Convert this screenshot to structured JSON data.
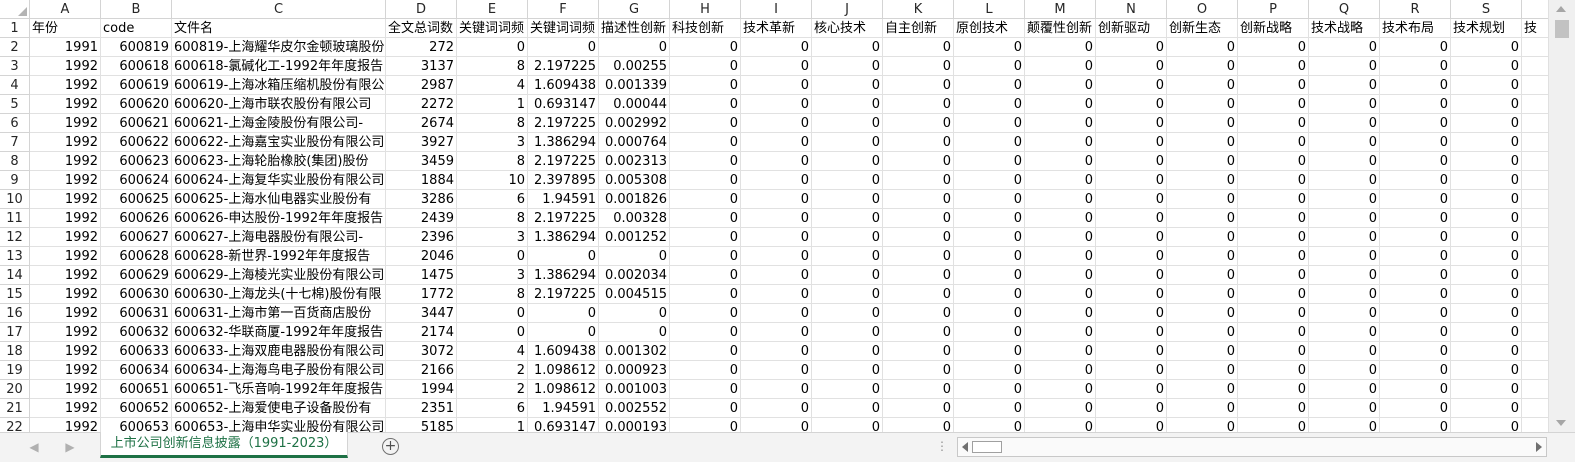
{
  "columns": [
    {
      "letter": "A",
      "header": "年份"
    },
    {
      "letter": "B",
      "header": "code"
    },
    {
      "letter": "C",
      "header": "文件名"
    },
    {
      "letter": "D",
      "header": "全文总词数"
    },
    {
      "letter": "E",
      "header": "关键词词频"
    },
    {
      "letter": "F",
      "header": "关键词词频"
    },
    {
      "letter": "G",
      "header": "描述性创新"
    },
    {
      "letter": "H",
      "header": "科技创新"
    },
    {
      "letter": "I",
      "header": "技术革新"
    },
    {
      "letter": "J",
      "header": "核心技术"
    },
    {
      "letter": "K",
      "header": "自主创新"
    },
    {
      "letter": "L",
      "header": "原创技术"
    },
    {
      "letter": "M",
      "header": "颠覆性创新"
    },
    {
      "letter": "N",
      "header": "创新驱动"
    },
    {
      "letter": "O",
      "header": "创新生态"
    },
    {
      "letter": "P",
      "header": "创新战略"
    },
    {
      "letter": "Q",
      "header": "技术战略"
    },
    {
      "letter": "R",
      "header": "技术布局"
    },
    {
      "letter": "S",
      "header": "技术规划"
    },
    {
      "letter": "",
      "header": "技"
    }
  ],
  "rows": [
    [
      "1991",
      "600819",
      "600819-上海耀华皮尔金顿玻璃股份",
      "272",
      "0",
      "0",
      "0",
      "0",
      "0",
      "0",
      "0",
      "0",
      "0",
      "0",
      "0",
      "0",
      "0",
      "0",
      "0",
      "0"
    ],
    [
      "1992",
      "600618",
      "600618-氯碱化工-1992年年度报告",
      "3137",
      "8",
      "2.197225",
      "0.00255",
      "0",
      "0",
      "0",
      "0",
      "0",
      "0",
      "0",
      "0",
      "0",
      "0",
      "0",
      "0",
      "0"
    ],
    [
      "1992",
      "600619",
      "600619-上海冰箱压缩机股份有限公司",
      "2987",
      "4",
      "1.609438",
      "0.001339",
      "0",
      "0",
      "0",
      "0",
      "0",
      "0",
      "0",
      "0",
      "0",
      "0",
      "0",
      "0",
      "0"
    ],
    [
      "1992",
      "600620",
      "600620-上海市联农股份有限公司",
      "2272",
      "1",
      "0.693147",
      "0.00044",
      "0",
      "0",
      "0",
      "0",
      "0",
      "0",
      "0",
      "0",
      "0",
      "0",
      "0",
      "0",
      "0"
    ],
    [
      "1992",
      "600621",
      "600621-上海金陵股份有限公司-",
      "2674",
      "8",
      "2.197225",
      "0.002992",
      "0",
      "0",
      "0",
      "0",
      "0",
      "0",
      "0",
      "0",
      "0",
      "0",
      "0",
      "0",
      "0"
    ],
    [
      "1992",
      "600622",
      "600622-上海嘉宝实业股份有限公司",
      "3927",
      "3",
      "1.386294",
      "0.000764",
      "0",
      "0",
      "0",
      "0",
      "0",
      "0",
      "0",
      "0",
      "0",
      "0",
      "0",
      "0",
      "0"
    ],
    [
      "1992",
      "600623",
      "600623-上海轮胎橡胶(集团)股份",
      "3459",
      "8",
      "2.197225",
      "0.002313",
      "0",
      "0",
      "0",
      "0",
      "0",
      "0",
      "0",
      "0",
      "0",
      "0",
      "0",
      "0",
      "0"
    ],
    [
      "1992",
      "600624",
      "600624-上海复华实业股份有限公司",
      "1884",
      "10",
      "2.397895",
      "0.005308",
      "0",
      "0",
      "0",
      "0",
      "0",
      "0",
      "0",
      "0",
      "0",
      "0",
      "0",
      "0",
      "0"
    ],
    [
      "1992",
      "600625",
      "600625-上海水仙电器实业股份有",
      "3286",
      "6",
      "1.94591",
      "0.001826",
      "0",
      "0",
      "0",
      "0",
      "0",
      "0",
      "0",
      "0",
      "0",
      "0",
      "0",
      "0",
      "0"
    ],
    [
      "1992",
      "600626",
      "600626-申达股份-1992年年度报告",
      "2439",
      "8",
      "2.197225",
      "0.00328",
      "0",
      "0",
      "0",
      "0",
      "0",
      "0",
      "0",
      "0",
      "0",
      "0",
      "0",
      "0",
      "0"
    ],
    [
      "1992",
      "600627",
      "600627-上海电器股份有限公司-",
      "2396",
      "3",
      "1.386294",
      "0.001252",
      "0",
      "0",
      "0",
      "0",
      "0",
      "0",
      "0",
      "0",
      "0",
      "0",
      "0",
      "0",
      "0"
    ],
    [
      "1992",
      "600628",
      "600628-新世界-1992年年度报告",
      "2046",
      "0",
      "0",
      "0",
      "0",
      "0",
      "0",
      "0",
      "0",
      "0",
      "0",
      "0",
      "0",
      "0",
      "0",
      "0",
      "0"
    ],
    [
      "1992",
      "600629",
      "600629-上海棱光实业股份有限公司",
      "1475",
      "3",
      "1.386294",
      "0.002034",
      "0",
      "0",
      "0",
      "0",
      "0",
      "0",
      "0",
      "0",
      "0",
      "0",
      "0",
      "0",
      "0"
    ],
    [
      "1992",
      "600630",
      "600630-上海龙头(十七棉)股份有限",
      "1772",
      "8",
      "2.197225",
      "0.004515",
      "0",
      "0",
      "0",
      "0",
      "0",
      "0",
      "0",
      "0",
      "0",
      "0",
      "0",
      "0",
      "0"
    ],
    [
      "1992",
      "600631",
      "600631-上海市第一百货商店股份",
      "3447",
      "0",
      "0",
      "0",
      "0",
      "0",
      "0",
      "0",
      "0",
      "0",
      "0",
      "0",
      "0",
      "0",
      "0",
      "0",
      "0"
    ],
    [
      "1992",
      "600632",
      "600632-华联商厦-1992年年度报告",
      "2174",
      "0",
      "0",
      "0",
      "0",
      "0",
      "0",
      "0",
      "0",
      "0",
      "0",
      "0",
      "0",
      "0",
      "0",
      "0",
      "0"
    ],
    [
      "1992",
      "600633",
      "600633-上海双鹿电器股份有限公司",
      "3072",
      "4",
      "1.609438",
      "0.001302",
      "0",
      "0",
      "0",
      "0",
      "0",
      "0",
      "0",
      "0",
      "0",
      "0",
      "0",
      "0",
      "0"
    ],
    [
      "1992",
      "600634",
      "600634-上海海鸟电子股份有限公司",
      "2166",
      "2",
      "1.098612",
      "0.000923",
      "0",
      "0",
      "0",
      "0",
      "0",
      "0",
      "0",
      "0",
      "0",
      "0",
      "0",
      "0",
      "0"
    ],
    [
      "1992",
      "600651",
      "600651-飞乐音响-1992年年度报告",
      "1994",
      "2",
      "1.098612",
      "0.001003",
      "0",
      "0",
      "0",
      "0",
      "0",
      "0",
      "0",
      "0",
      "0",
      "0",
      "0",
      "0",
      "0"
    ],
    [
      "1992",
      "600652",
      "600652-上海爱使电子设备股份有",
      "2351",
      "6",
      "1.94591",
      "0.002552",
      "0",
      "0",
      "0",
      "0",
      "0",
      "0",
      "0",
      "0",
      "0",
      "0",
      "0",
      "0",
      "0"
    ],
    [
      "1992",
      "600653",
      "600653-上海申华实业股份有限公司",
      "5185",
      "1",
      "0.693147",
      "0.000193",
      "0",
      "0",
      "0",
      "0",
      "0",
      "0",
      "0",
      "0",
      "0",
      "0",
      "0",
      "0",
      "0"
    ]
  ],
  "sheet_tab": "上市公司创新信息披露（1991-2023）",
  "add_sheet_label": "+",
  "colors": {
    "tab_accent": "#1e7145",
    "grid_line": "#e1e1e1",
    "header_border": "#d4d4d4"
  },
  "icons": {
    "add_sheet": "plus-circle-icon",
    "nav_prev": "chevron-left-icon",
    "nav_next": "chevron-right-icon"
  }
}
